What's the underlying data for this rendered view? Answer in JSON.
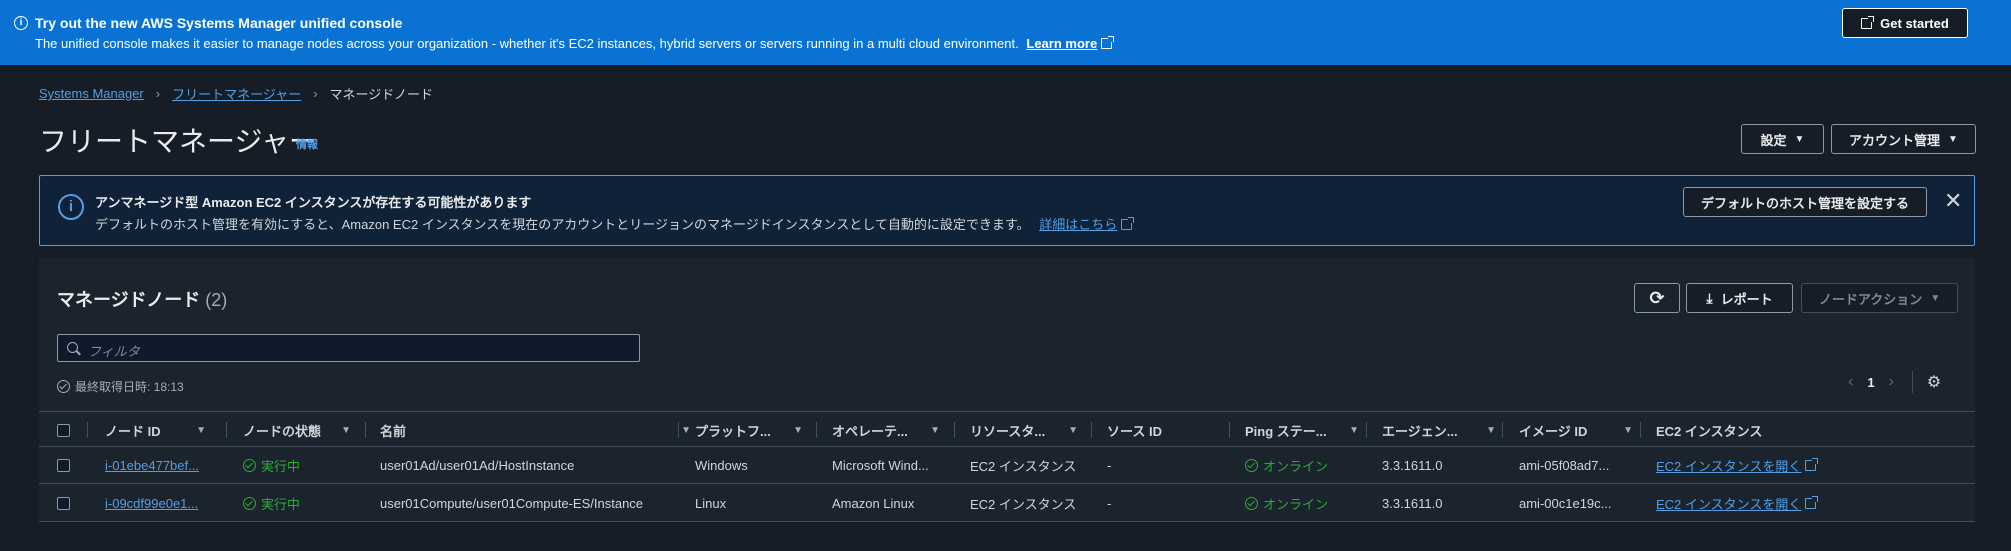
{
  "banner": {
    "title": "Try out the new AWS Systems Manager unified console",
    "description": "The unified console makes it easier to manage nodes across your organization - whether it's EC2 instances, hybrid servers or servers running in a multi cloud environment.",
    "learn_more": "Learn more",
    "get_started": "Get started"
  },
  "breadcrumb": {
    "items": [
      "Systems Manager",
      "フリートマネージャー"
    ],
    "current": "マネージドノード"
  },
  "header": {
    "title": "フリートマネージャー",
    "info": "情報",
    "settings_label": "設定",
    "account_label": "アカウント管理"
  },
  "alert": {
    "title": "アンマネージド型 Amazon EC2 インスタンスが存在する可能性があります",
    "description": "デフォルトのホスト管理を有効にすると、Amazon EC2 インスタンスを現在のアカウントとリージョンのマネージドインスタンスとして自動的に設定できます。",
    "link": "詳細はこちら",
    "button": "デフォルトのホスト管理を設定する"
  },
  "panel": {
    "title": "マネージドノード",
    "count": "(2)",
    "report_label": "レポート",
    "node_action_label": "ノードアクション",
    "filter_placeholder": "フィルタ",
    "last_fetched": "最終取得日時: 18:13",
    "page": "1"
  },
  "table": {
    "columns": [
      "ノード ID",
      "ノードの状態",
      "名前",
      "プラットフ...",
      "オペレーテ...",
      "リソースタ...",
      "ソース ID",
      "Ping ステー...",
      "エージェン...",
      "イメージ ID",
      "EC2 インスタンス"
    ],
    "rows": [
      {
        "node_id": "i-01ebe477bef...",
        "state": "実行中",
        "name": "user01Ad/user01Ad/HostInstance",
        "platform": "Windows",
        "os": "Microsoft Wind...",
        "resource_type": "EC2 インスタンス",
        "source_id": "-",
        "ping": "オンライン",
        "agent": "3.3.1611.0",
        "image_id": "ami-05f08ad7...",
        "ec2_link": "EC2 インスタンスを開く"
      },
      {
        "node_id": "i-09cdf99e0e1...",
        "state": "実行中",
        "name": "user01Compute/user01Compute-ES/Instance",
        "platform": "Linux",
        "os": "Amazon Linux",
        "resource_type": "EC2 インスタンス",
        "source_id": "-",
        "ping": "オンライン",
        "agent": "3.3.1611.0",
        "image_id": "ami-00c1e19c...",
        "ec2_link": "EC2 インスタンスを開く"
      }
    ]
  },
  "colors": {
    "banner_bg": "#0972d3",
    "link": "#539fe5",
    "success": "#29ad32",
    "page_bg": "#161d26"
  }
}
